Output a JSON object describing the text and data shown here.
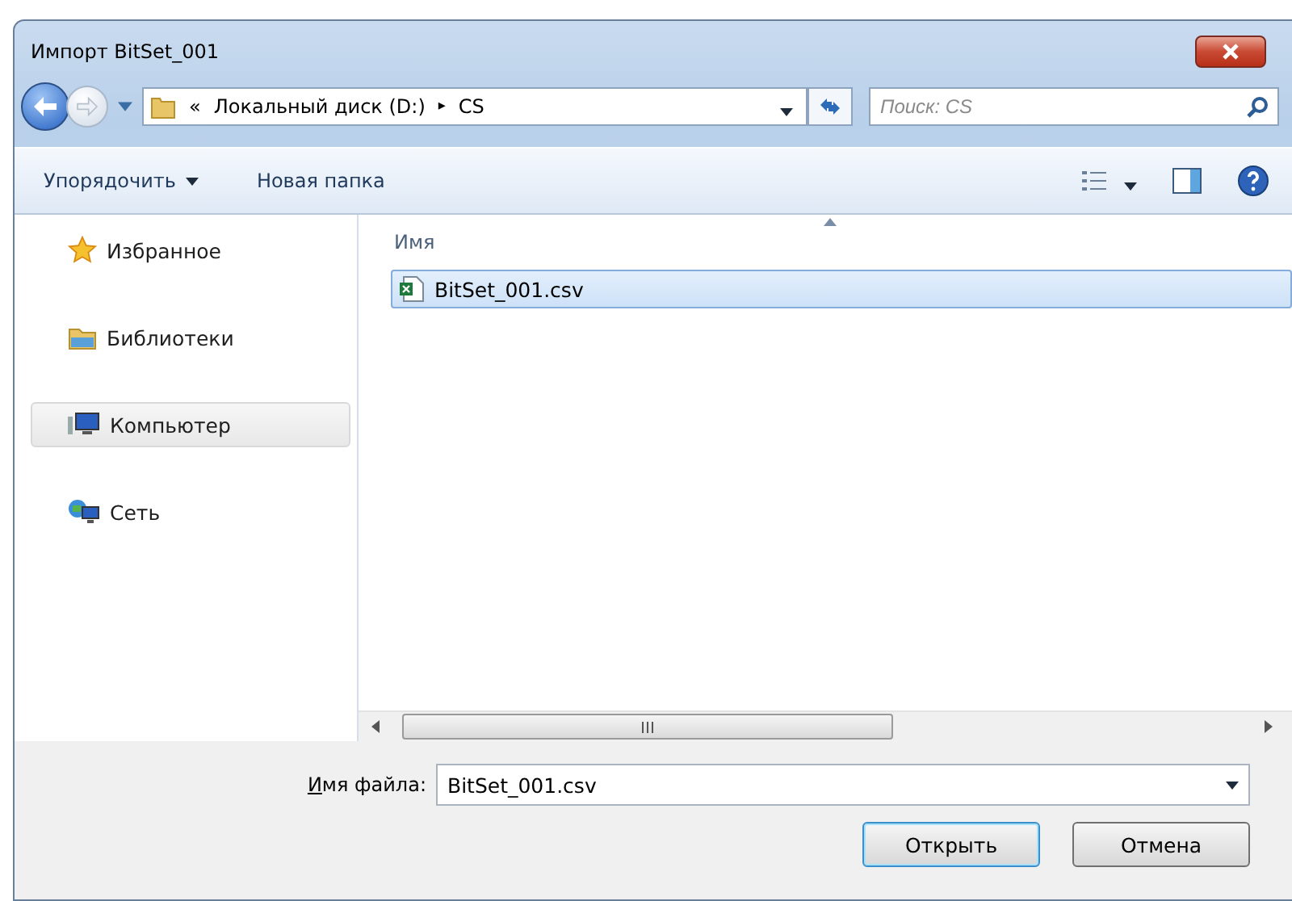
{
  "window": {
    "title": "Импорт BitSet_001"
  },
  "address": {
    "overflow": "«",
    "crumbs": [
      "Локальный диск (D:)",
      "CS"
    ],
    "separator": "▸"
  },
  "search": {
    "placeholder": "Поиск: CS"
  },
  "toolbar": {
    "organize": "Упорядочить",
    "new_folder": "Новая папка"
  },
  "sidebar": {
    "items": [
      {
        "label": "Избранное",
        "kind": "star",
        "selected": false
      },
      {
        "label": "Библиотеки",
        "kind": "library",
        "selected": false
      },
      {
        "label": "Компьютер",
        "kind": "computer",
        "selected": true
      },
      {
        "label": "Сеть",
        "kind": "network",
        "selected": false
      }
    ]
  },
  "file_list": {
    "columns": [
      "Имя"
    ],
    "rows": [
      {
        "name": "BitSet_001.csv",
        "selected": true
      }
    ]
  },
  "filename": {
    "label": "Имя файла:",
    "value": "BitSet_001.csv"
  },
  "buttons": [
    {
      "label": "Открыть",
      "default": true
    },
    {
      "label": "Отмена",
      "default": false
    }
  ]
}
